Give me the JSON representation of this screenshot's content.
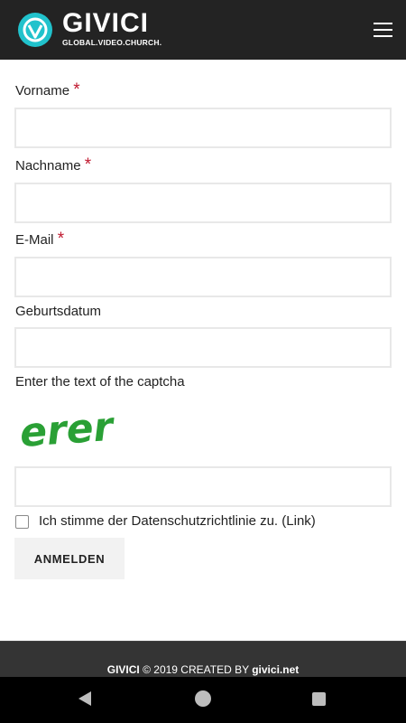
{
  "header": {
    "logo_text": "GIVICI",
    "logo_tagline": "GLOBAL.VIDEO.CHURCH."
  },
  "form": {
    "firstname_label": "Vorname",
    "lastname_label": "Nachname",
    "email_label": "E-Mail",
    "birthdate_label": "Geburtsdatum",
    "captcha_label": "Enter the text of the captcha",
    "captcha_text": "erer",
    "required_marker": "*",
    "privacy_label": "Ich stimme der Datenschutzrichtlinie zu. (Link)",
    "submit_label": "ANMELDEN"
  },
  "footer": {
    "brand": "GIVICI",
    "copyright": " © 2019 CREATED BY ",
    "site": "givici.net"
  },
  "colors": {
    "header_bg": "#232323",
    "required": "#c0192f",
    "logo_accent": "#21c2cc",
    "captcha_green": "#2aa035"
  }
}
